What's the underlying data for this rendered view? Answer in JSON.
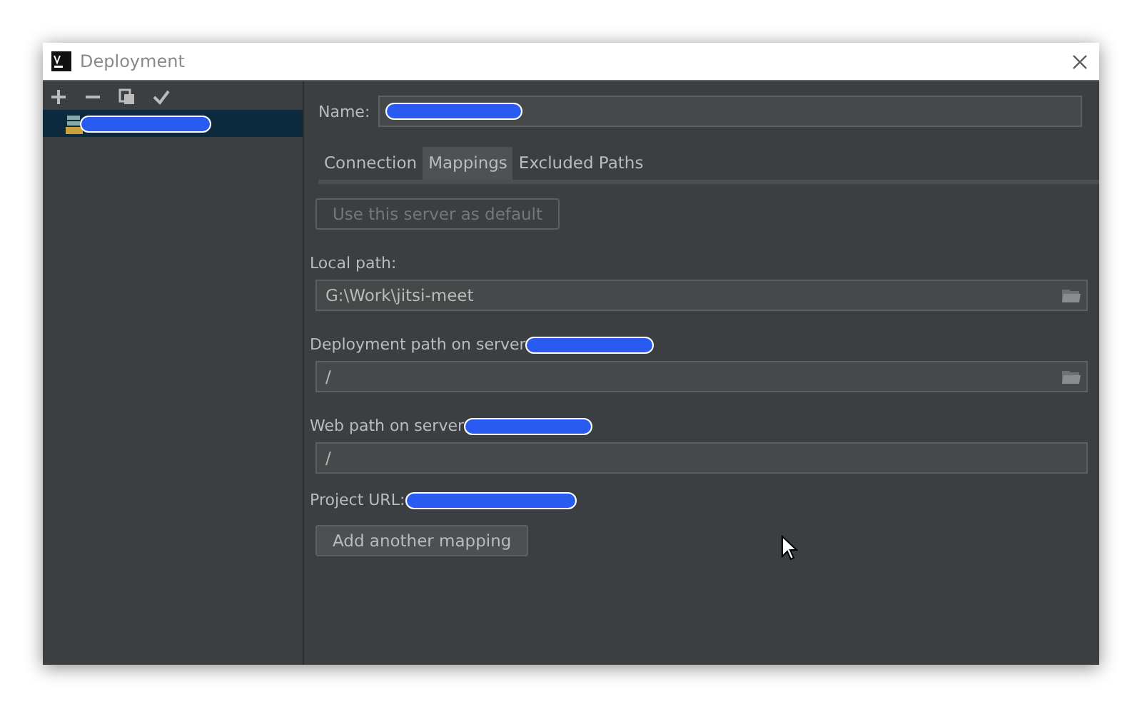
{
  "window": {
    "title": "Deployment"
  },
  "sidebar": {
    "toolbar": [
      {
        "kind": "add"
      },
      {
        "kind": "remove"
      },
      {
        "kind": "copy"
      },
      {
        "kind": "check"
      }
    ],
    "items": [
      {
        "redacted": true,
        "selected": true
      }
    ]
  },
  "name_field": {
    "label": "Name:",
    "redacted": true
  },
  "tabs": [
    {
      "label": "Connection",
      "selected": false
    },
    {
      "label": "Mappings",
      "selected": true
    },
    {
      "label": "Excluded Paths",
      "selected": false
    }
  ],
  "default_button": {
    "label": "Use this server as default",
    "disabled": true
  },
  "mapping": [
    {
      "label": "Local path:",
      "redacted": false,
      "value": "G:\\Work\\jitsi-meet",
      "browse": true
    },
    {
      "label": "Deployment path on server",
      "redacted": true,
      "value": "/",
      "browse": true
    },
    {
      "label": "Web path on server",
      "redacted": true,
      "value": "/",
      "browse": false
    }
  ],
  "project_url": {
    "label": "Project URL:",
    "redacted": true
  },
  "add_button": {
    "label": "Add another mapping",
    "disabled": false
  }
}
